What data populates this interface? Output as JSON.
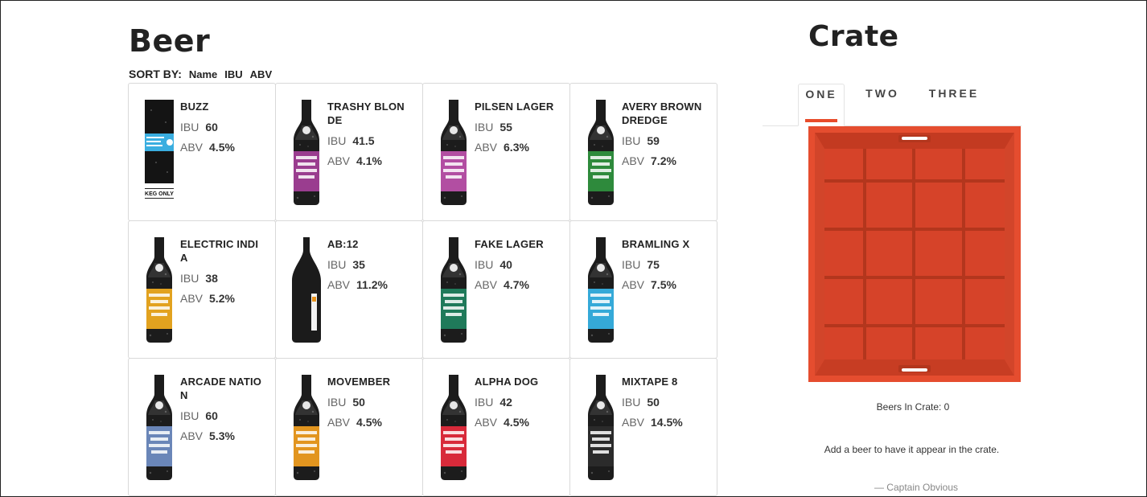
{
  "beer_section": {
    "title": "Beer",
    "sort_label": "SORT BY:",
    "sort_options": [
      "Name",
      "IBU",
      "ABV"
    ]
  },
  "labels": {
    "ibu": "IBU",
    "abv": "ABV"
  },
  "beers": [
    {
      "name": "BUZZ",
      "ibu": "60",
      "abv": "4.5%",
      "image": "keg-icon",
      "keg_text": "KEG ONLY",
      "label_color": "#3aaee0"
    },
    {
      "name": "TRASHY BLONDE",
      "ibu": "41.5",
      "abv": "4.1%",
      "image": "bottle-icon",
      "label_color": "#9a3d8f"
    },
    {
      "name": "PILSEN LAGER",
      "ibu": "55",
      "abv": "6.3%",
      "image": "bottle-icon",
      "label_color": "#b24ea2"
    },
    {
      "name": "AVERY BROWN DREDGE",
      "ibu": "59",
      "abv": "7.2%",
      "image": "bottle-icon",
      "label_color": "#2e8a3c"
    },
    {
      "name": "ELECTRIC INDIA",
      "ibu": "38",
      "abv": "5.2%",
      "image": "bottle-icon",
      "label_color": "#e2a21f"
    },
    {
      "name": "AB:12",
      "ibu": "35",
      "abv": "11.2%",
      "image": "bottle-icon",
      "label_color": "#1e1e1e"
    },
    {
      "name": "FAKE LAGER",
      "ibu": "40",
      "abv": "4.7%",
      "image": "bottle-icon",
      "label_color": "#1f7a5a"
    },
    {
      "name": "BRAMLING X",
      "ibu": "75",
      "abv": "7.5%",
      "image": "bottle-icon",
      "label_color": "#35a9d8"
    },
    {
      "name": "ARCADE NATION",
      "ibu": "60",
      "abv": "5.3%",
      "image": "bottle-icon",
      "label_color": "#6a86b8"
    },
    {
      "name": "MOVEMBER",
      "ibu": "50",
      "abv": "4.5%",
      "image": "bottle-icon",
      "label_color": "#e2951f"
    },
    {
      "name": "ALPHA DOG",
      "ibu": "42",
      "abv": "4.5%",
      "image": "bottle-icon",
      "label_color": "#d82a3a"
    },
    {
      "name": "MIXTAPE 8",
      "ibu": "50",
      "abv": "14.5%",
      "image": "bottle-icon",
      "label_color": "#2b2b2b"
    }
  ],
  "crate_section": {
    "title": "Crate",
    "tabs": [
      "ONE",
      "TWO",
      "THREE"
    ],
    "active_tab": "ONE",
    "beers_in_crate_text": "Beers In Crate: 0",
    "hint": "Add a beer to have it appear in the crate.",
    "quote": "— Captain Obvious",
    "crate_color": "#d84a2e",
    "accent_color": "#e84c2b"
  }
}
